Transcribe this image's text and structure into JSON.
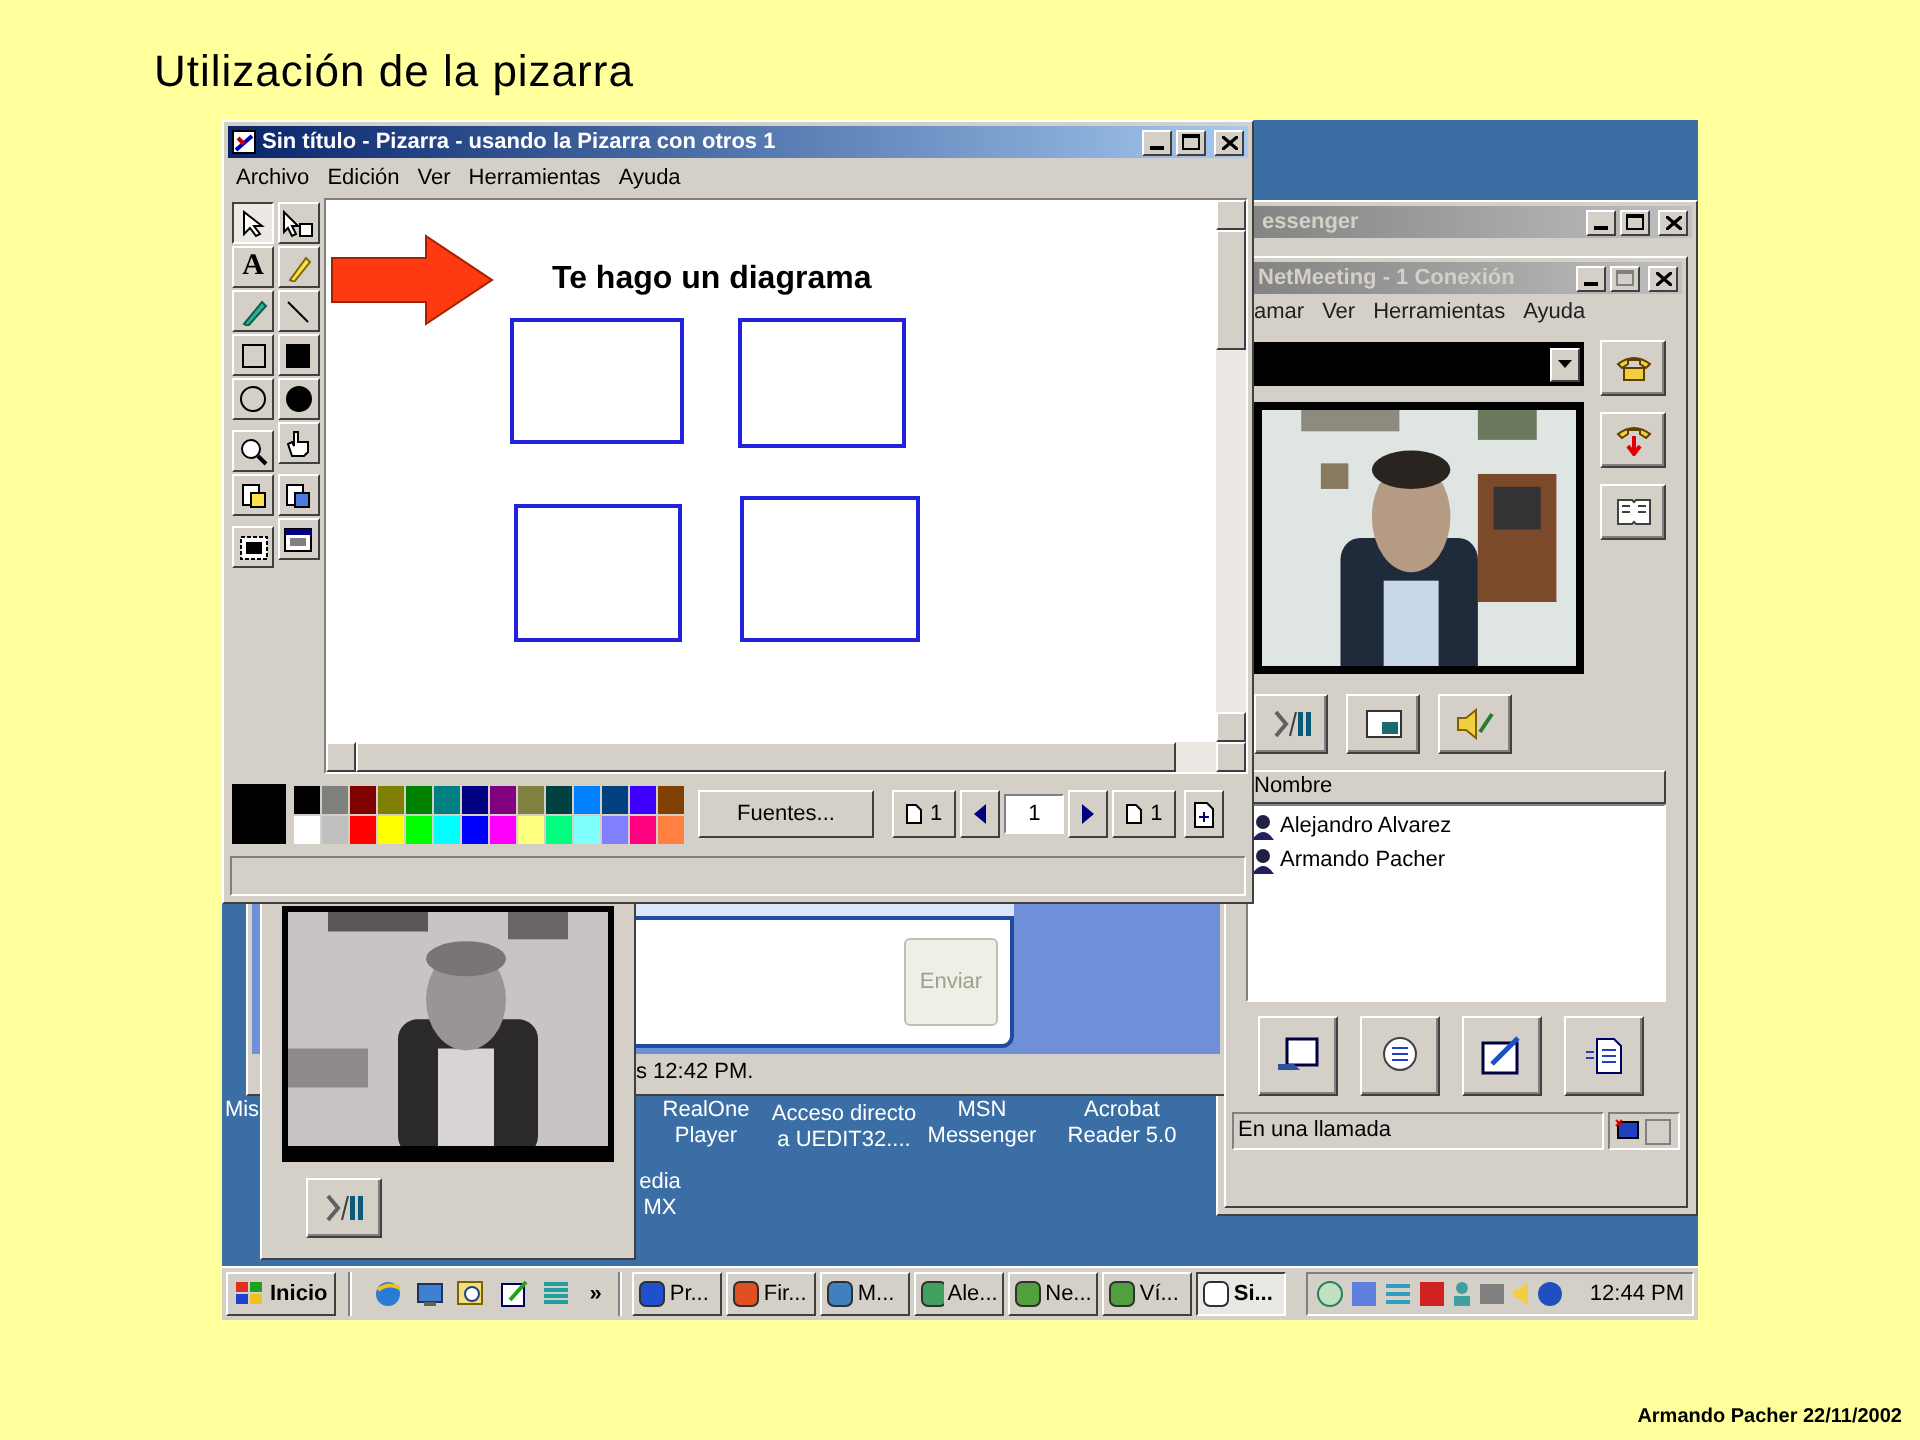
{
  "slide": {
    "title": "Utilización de la pizarra",
    "footer": "Armando Pacher 22/11/2002"
  },
  "whiteboard": {
    "title": "Sin título - Pizarra - usando la Pizarra con otros 1",
    "menu": [
      "Archivo",
      "Edición",
      "Ver",
      "Herramientas",
      "Ayuda"
    ],
    "tools": [
      {
        "kind": "select",
        "selected": true
      },
      {
        "kind": "eraser",
        "selected": false
      },
      {
        "kind": "text",
        "label": "A",
        "selected": false
      },
      {
        "kind": "highlighter",
        "selected": false
      },
      {
        "kind": "pen",
        "selected": false
      },
      {
        "kind": "line",
        "selected": false
      },
      {
        "kind": "rect",
        "selected": false
      },
      {
        "kind": "filled-rect",
        "selected": false
      },
      {
        "kind": "ellipse",
        "selected": false
      },
      {
        "kind": "filled-ellipse",
        "selected": false
      },
      {
        "kind": "zoom",
        "selected": false
      },
      {
        "kind": "pointer",
        "selected": false
      },
      {
        "kind": "lock",
        "selected": false
      },
      {
        "kind": "sync",
        "selected": false
      },
      {
        "kind": "area",
        "selected": false
      },
      {
        "kind": "window",
        "selected": false
      }
    ],
    "canvas_text": "Te hago un diagrama",
    "palette": [
      {
        "color": "#000000"
      },
      {
        "color": "#ffffff"
      },
      {
        "color": "#808080"
      },
      {
        "color": "#c0c0c0"
      },
      {
        "color": "#800000"
      },
      {
        "color": "#ff0000"
      },
      {
        "color": "#808000"
      },
      {
        "color": "#ffff00"
      },
      {
        "color": "#008000"
      },
      {
        "color": "#00ff00"
      },
      {
        "color": "#008080"
      },
      {
        "color": "#00ffff"
      },
      {
        "color": "#000080"
      },
      {
        "color": "#0000ff"
      },
      {
        "color": "#800080"
      },
      {
        "color": "#ff00ff"
      },
      {
        "color": "#808040"
      },
      {
        "color": "#ffff80"
      },
      {
        "color": "#004040"
      },
      {
        "color": "#00ff80"
      },
      {
        "color": "#0080ff"
      },
      {
        "color": "#80ffff"
      },
      {
        "color": "#004080"
      },
      {
        "color": "#8080ff"
      },
      {
        "color": "#4000ff"
      },
      {
        "color": "#ff0080"
      },
      {
        "color": "#804000"
      },
      {
        "color": "#ff8040"
      }
    ],
    "fonts_button": "Fuentes...",
    "page_first": "1",
    "page_field": "1",
    "page_last": "1"
  },
  "messenger": {
    "title": "essenger"
  },
  "netmeeting": {
    "title": "NetMeeting - 1 Conexión",
    "menu": [
      "amar",
      "Ver",
      "Herramientas",
      "Ayuda"
    ],
    "list_header": "Nombre",
    "participants": [
      "Alejandro Alvarez",
      "Armando Pacher"
    ],
    "status": "En una llamada"
  },
  "chat": {
    "send_button": "Enviar",
    "disabled": true,
    "status": "s 12:42 PM."
  },
  "desktop_icons": [
    {
      "lines": [
        "Mis"
      ]
    },
    {
      "lines": [
        "RealOne",
        "Player"
      ]
    },
    {
      "lines": [
        "Acceso directo",
        "a UEDIT32...."
      ]
    },
    {
      "lines": [
        "MSN",
        "Messenger"
      ]
    },
    {
      "lines": [
        "Acrobat",
        "Reader 5.0"
      ]
    },
    {
      "lines": [
        "edia",
        "MX"
      ]
    }
  ],
  "taskbar": {
    "start": "Inicio",
    "more": "»",
    "tasks": [
      {
        "label": "Pr...",
        "selected": false
      },
      {
        "label": "Fir...",
        "selected": false
      },
      {
        "label": "M...",
        "selected": false
      },
      {
        "label": "Ale...",
        "selected": false
      },
      {
        "label": "Ne...",
        "selected": false
      },
      {
        "label": "Ví...",
        "selected": false
      },
      {
        "label": "Si...",
        "selected": true
      }
    ],
    "clock": "12:44 PM"
  }
}
